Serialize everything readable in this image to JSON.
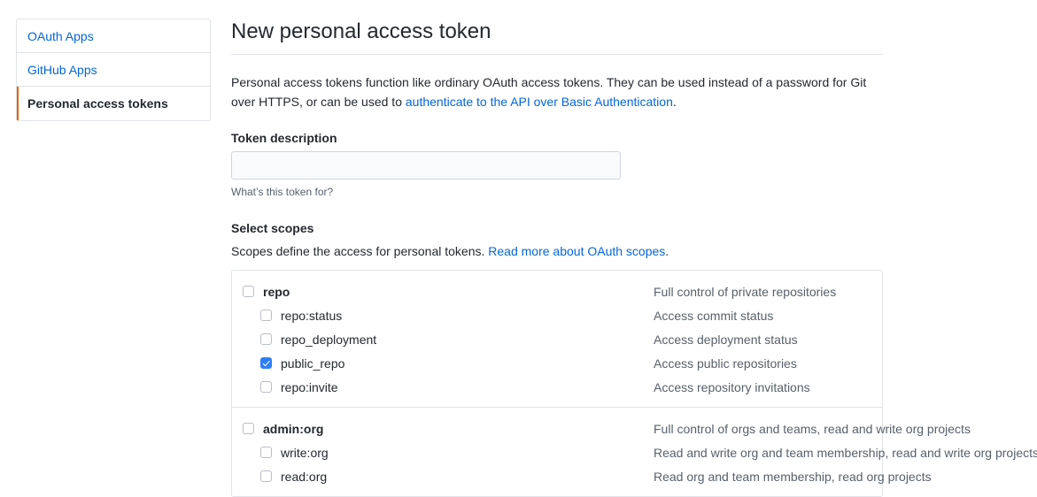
{
  "sidebar": {
    "items": [
      {
        "label": "OAuth Apps",
        "selected": false
      },
      {
        "label": "GitHub Apps",
        "selected": false
      },
      {
        "label": "Personal access tokens",
        "selected": true
      }
    ],
    "accent_color": "#e36209"
  },
  "main": {
    "title": "New personal access token",
    "intro": {
      "text_before": "Personal access tokens function like ordinary OAuth access tokens. They can be used instead of a password for Git over HTTPS, or can be used to ",
      "link_text": "authenticate to the API over Basic Authentication",
      "text_after": "."
    },
    "token_description": {
      "label": "Token description",
      "value": "",
      "placeholder": "",
      "note": "What’s this token for?"
    },
    "scopes": {
      "heading": "Select scopes",
      "sub_text_before": "Scopes define the access for personal tokens. ",
      "sub_link_text": "Read more about OAuth scopes",
      "sub_text_after": ".",
      "groups": [
        {
          "parent": {
            "name": "repo",
            "description": "Full control of private repositories",
            "checked": false
          },
          "children": [
            {
              "name": "repo:status",
              "description": "Access commit status",
              "checked": false
            },
            {
              "name": "repo_deployment",
              "description": "Access deployment status",
              "checked": false
            },
            {
              "name": "public_repo",
              "description": "Access public repositories",
              "checked": true
            },
            {
              "name": "repo:invite",
              "description": "Access repository invitations",
              "checked": false
            }
          ]
        },
        {
          "parent": {
            "name": "admin:org",
            "description": "Full control of orgs and teams, read and write org projects",
            "checked": false
          },
          "children": [
            {
              "name": "write:org",
              "description": "Read and write org and team membership, read and write org projects",
              "checked": false
            },
            {
              "name": "read:org",
              "description": "Read org and team membership, read org projects",
              "checked": false
            }
          ]
        }
      ]
    }
  },
  "colors": {
    "link": "#0366d6",
    "checkbox_checked": "#2d7ff9",
    "border": "#e1e4e8",
    "text": "#24292e",
    "muted": "#586069"
  }
}
